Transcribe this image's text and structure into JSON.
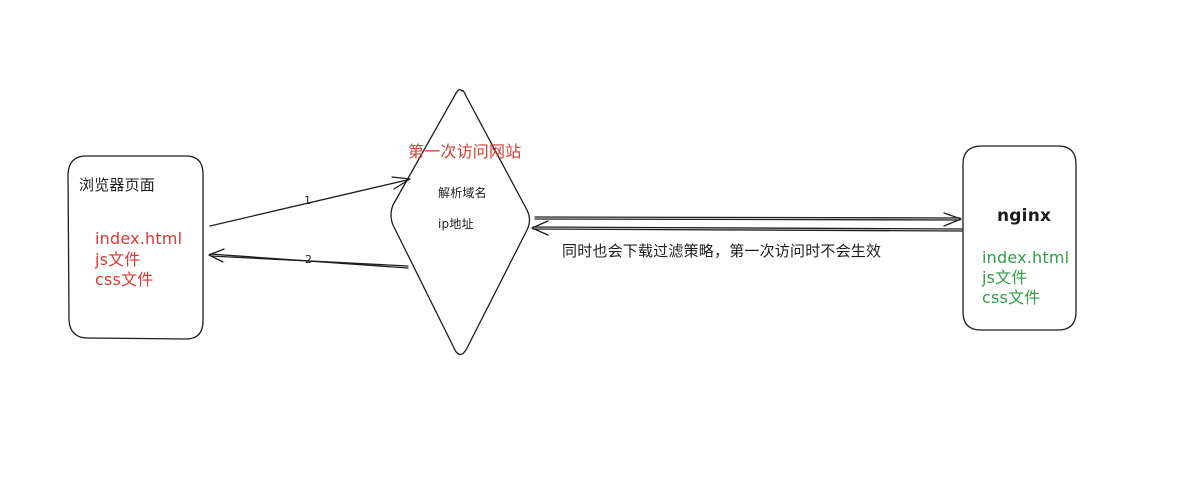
{
  "browser": {
    "title": "浏览器页面",
    "files": [
      "index.html",
      "js文件",
      "css文件"
    ]
  },
  "dns": {
    "heading": "第一次访问网站",
    "line1": "解析域名",
    "line2": "ip地址"
  },
  "nginx": {
    "title": "nginx",
    "files": [
      "index.html",
      "js文件",
      "css文件"
    ]
  },
  "arrows": {
    "request_label": "1",
    "response_label": "2"
  },
  "note": "同时也会下载过滤策略，第一次访问时不会生效",
  "colors": {
    "stroke": "#1e1e1e",
    "red_text": "#d63a33",
    "green_text": "#2f9e44"
  }
}
